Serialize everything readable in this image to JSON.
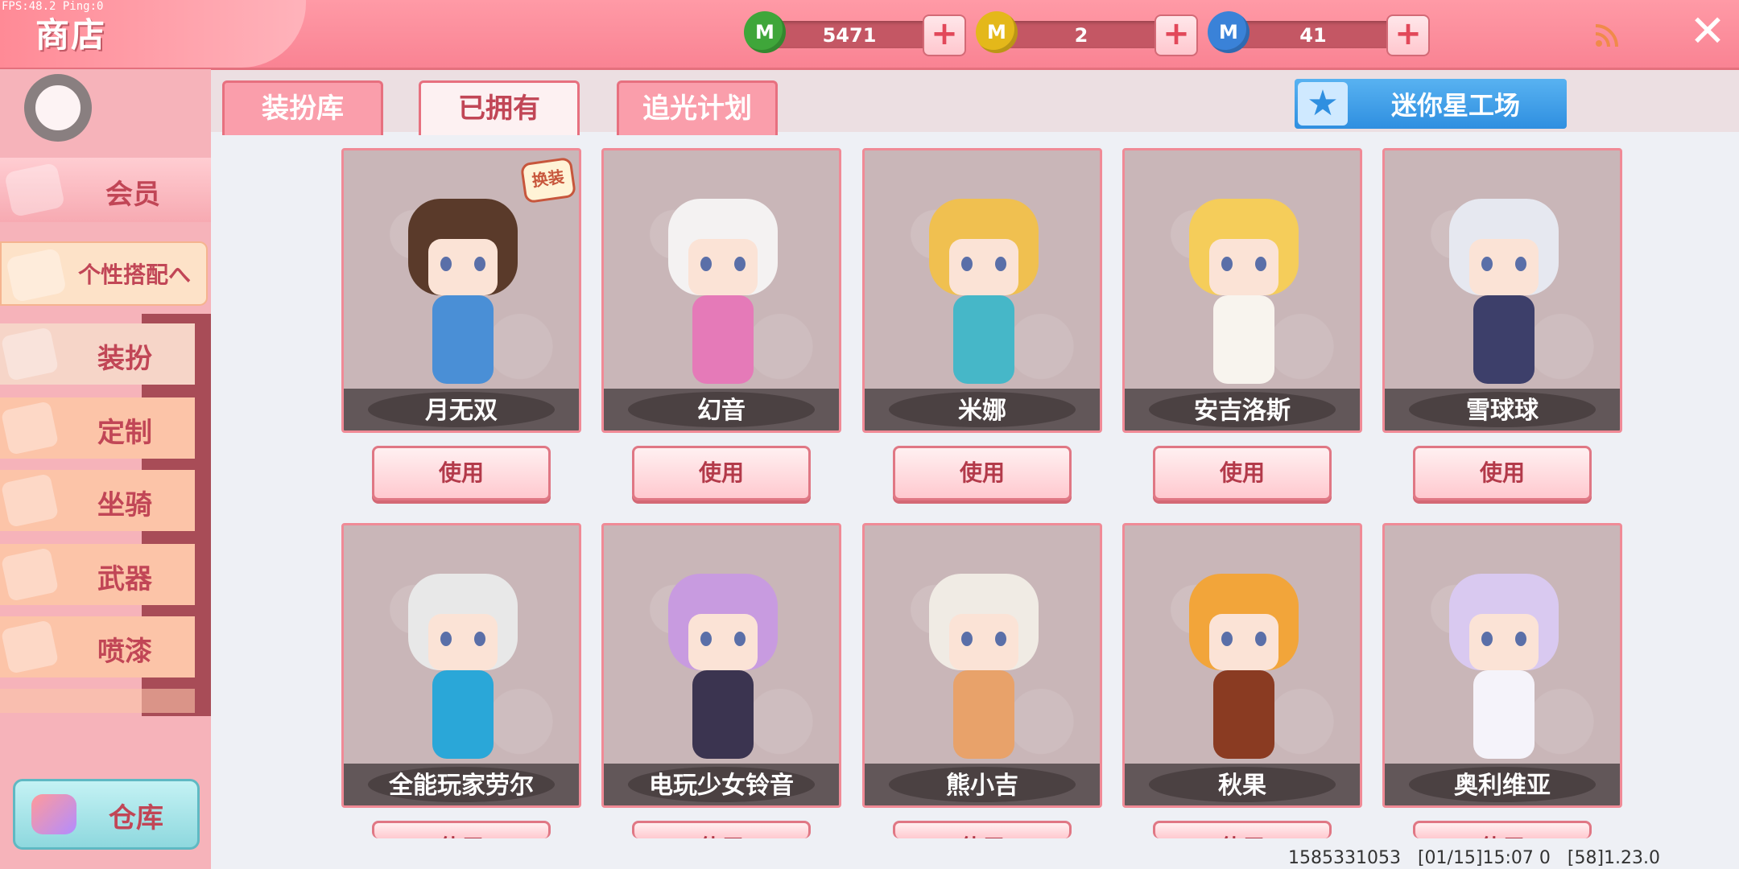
{
  "debug": "FPS:48.2  Ping:0",
  "header": {
    "title": "商店",
    "currencies": [
      {
        "icon": "green-mini-coin-icon",
        "letter": "M",
        "amount": "5471",
        "color": "#3fa63a"
      },
      {
        "icon": "gold-mini-coin-icon",
        "letter": "M",
        "amount": "2",
        "color": "#e4b81a"
      },
      {
        "icon": "blue-mini-coin-icon",
        "letter": "M",
        "amount": "41",
        "color": "#3a82d8"
      }
    ],
    "plus": "+",
    "close": "✕"
  },
  "sidebar": {
    "member": "会员",
    "outfit_menu": "个性搭配",
    "outfit_menu_arrow": "へ",
    "items": [
      "装扮",
      "定制",
      "坐骑",
      "武器",
      "喷漆"
    ],
    "warehouse": "仓库"
  },
  "tabs": [
    "装扮库",
    "已拥有",
    "追光计划"
  ],
  "active_tab": 1,
  "star_workshop": "迷你星工场",
  "cards": [
    {
      "name": "月无双",
      "button": "使用",
      "hair": "#5a3a2a",
      "accent": "#4a8fd6",
      "badge": "换装"
    },
    {
      "name": "幻音",
      "button": "使用",
      "hair": "#f4f2f2",
      "accent": "#e57ab8"
    },
    {
      "name": "米娜",
      "button": "使用",
      "hair": "#f0c050",
      "accent": "#46b7c8"
    },
    {
      "name": "安吉洛斯",
      "button": "使用",
      "hair": "#f5cd5a",
      "accent": "#f8f4ee"
    },
    {
      "name": "雪球球",
      "button": "使用",
      "hair": "#e6e8f0",
      "accent": "#3d3f6a"
    },
    {
      "name": "全能玩家劳尔",
      "button": "使用",
      "hair": "#e8e8e8",
      "accent": "#2aa7d8"
    },
    {
      "name": "电玩少女铃音",
      "button": "使用",
      "hair": "#c89be0",
      "accent": "#3b3450"
    },
    {
      "name": "熊小吉",
      "button": "使用",
      "hair": "#f0ebe4",
      "accent": "#e8a26a"
    },
    {
      "name": "秋果",
      "button": "使用",
      "hair": "#f2a53a",
      "accent": "#8a3b22"
    },
    {
      "name": "奥利维亚",
      "button": "使用",
      "hair": "#d9c9f0",
      "accent": "#f5f3fa"
    }
  ],
  "footer": "1585331053   [01/15]15:07 0   [58]1.23.0"
}
